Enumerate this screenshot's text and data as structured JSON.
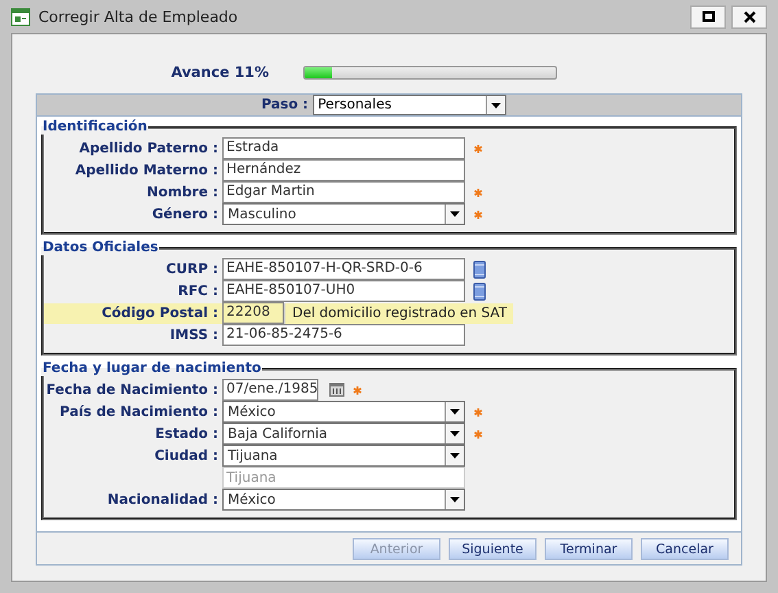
{
  "window": {
    "title": "Corregir Alta de Empleado"
  },
  "progress": {
    "label": "Avance 11%",
    "level": 0.11
  },
  "step": {
    "label": "Paso :",
    "value": "Personales"
  },
  "sections": [
    {
      "title": "Identificación",
      "fields": [
        {
          "label": "Apellido Paterno :",
          "kind": "text",
          "value": "Estrada",
          "required": true
        },
        {
          "label": "Apellido Materno :",
          "kind": "text",
          "value": "Hernández",
          "required": false
        },
        {
          "label": "Nombre :",
          "kind": "text",
          "value": "Edgar Martin",
          "required": true
        },
        {
          "label": "Género :",
          "kind": "select",
          "value": "Masculino",
          "required": true
        }
      ]
    },
    {
      "title": "Datos Oficiales",
      "fields": [
        {
          "label": "CURP :",
          "kind": "lookup",
          "value": "EAHE-850107-H-QR-SRD-0-6",
          "required": false
        },
        {
          "label": "RFC :",
          "kind": "lookup",
          "value": "EAHE-850107-UH0",
          "required": false
        },
        {
          "label": "Código Postal :",
          "kind": "hint",
          "value": "22208",
          "hint": "Del domicilio registrado en SAT",
          "required": false
        },
        {
          "label": "IMSS :",
          "kind": "text",
          "value": "21-06-85-2475-6",
          "required": false
        }
      ]
    },
    {
      "title": "Fecha y lugar de nacimiento",
      "fields": [
        {
          "label": "Fecha de Nacimiento :",
          "kind": "date",
          "value": "07/ene./1985",
          "required": true
        },
        {
          "label": "País de Nacimiento :",
          "kind": "select",
          "value": "México",
          "required": true
        },
        {
          "label": "Estado :",
          "kind": "select",
          "value": "Baja California",
          "required": true
        },
        {
          "label": "Ciudad :",
          "kind": "select",
          "value": "Tijuana",
          "required": false
        },
        {
          "kind": "readonly",
          "placeholder": "Tijuana",
          "required": false
        },
        {
          "label": "Nacionalidad :",
          "kind": "select",
          "value": "México",
          "required": false
        }
      ]
    }
  ],
  "buttons": [
    {
      "label": "Anterior",
      "disabled": true
    },
    {
      "label": "Siguiente",
      "disabled": false
    },
    {
      "label": "Terminar",
      "disabled": false
    },
    {
      "label": "Cancelar",
      "disabled": false
    }
  ]
}
